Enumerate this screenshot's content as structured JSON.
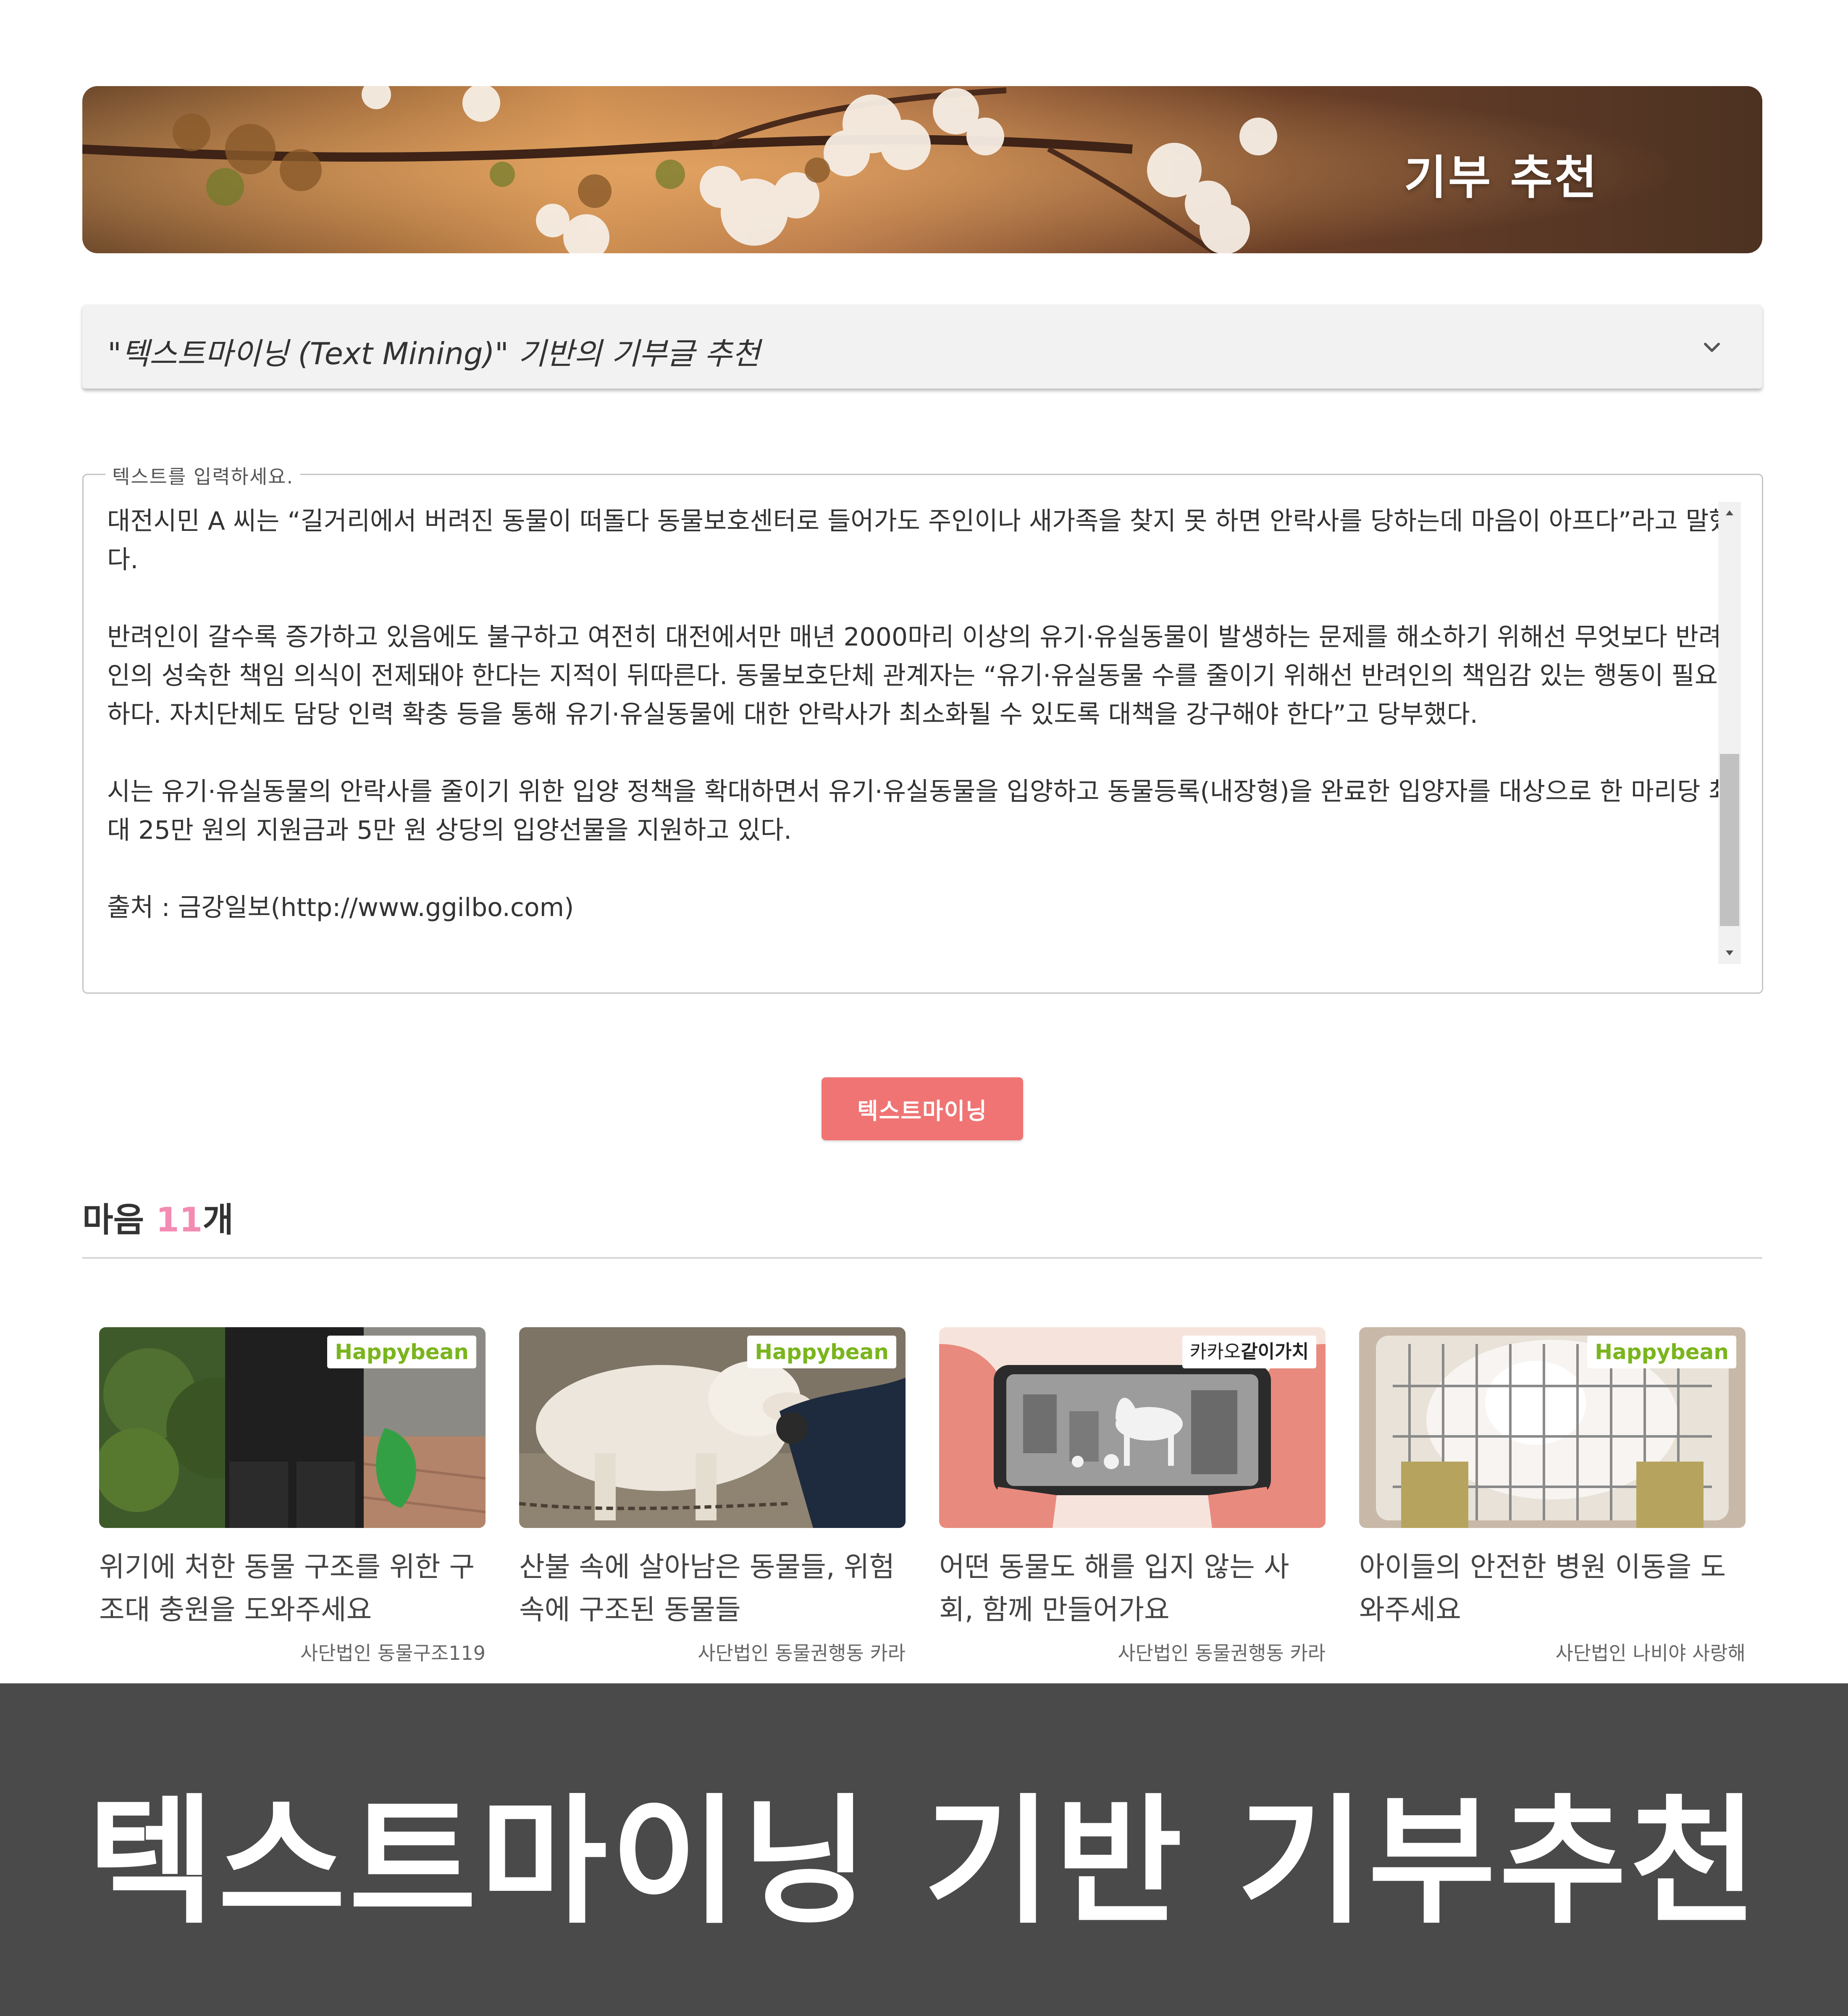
{
  "hero": {
    "title": "기부 추천"
  },
  "accordion": {
    "title": "\"텍스트마이닝 (Text Mining)\" 기반의 기부글 추천"
  },
  "text_input": {
    "legend": "텍스트를 입력하세요.",
    "paragraphs": [
      "대전시민 A 씨는 “길거리에서 버려진 동물이 떠돌다 동물보호센터로 들어가도 주인이나 새가족을 찾지 못 하면 안락사를 당하는데 마음이 아프다”라고 말했다.",
      "반려인이 갈수록 증가하고 있음에도 불구하고 여전히 대전에서만 매년 2000마리 이상의 유기·유실동물이 발생하는 문제를 해소하기 위해선 무엇보다 반려인의 성숙한 책임 의식이 전제돼야 한다는 지적이 뒤따른다. 동물보호단체 관계자는 “유기·유실동물 수를 줄이기 위해선 반려인의 책임감 있는 행동이 필요하다. 자치단체도 담당 인력 확충 등을 통해 유기·유실동물에 대한 안락사가 최소화될 수 있도록 대책을 강구해야 한다”고 당부했다.",
      "시는 유기·유실동물의 안락사를 줄이기 위한 입양 정책을 확대하면서 유기·유실동물을 입양하고 동물등록(내장형)을 완료한 입양자를 대상으로 한 마리당 최대 25만 원의 지원금과 5만 원 상당의 입양선물을 지원하고 있다.",
      "출처 : 금강일보(http://www.ggilbo.com)"
    ]
  },
  "action_button": {
    "label": "텍스트마이닝"
  },
  "results": {
    "prefix": "마음 ",
    "count": "11",
    "suffix": "개"
  },
  "cards": [
    {
      "badge": "Happybean",
      "title": "위기에 처한 동물 구조를 위한 구조대 충원을 도와주세요",
      "org": "사단법인 동물구조119",
      "image": "rescue-worker-photo"
    },
    {
      "badge": "Happybean",
      "title": "산불 속에 살아남은 동물들, 위험 속에 구조된 동물들",
      "org": "사단법인 동물권행동 카라",
      "image": "white-dog-photo"
    },
    {
      "badge_prefix": "카카오",
      "badge": "같이가치",
      "title": "어떤 동물도 해를 입지 않는 사회, 함께 만들어가요",
      "org": "사단법인 동물권행동 카라",
      "image": "phone-horse-illustration"
    },
    {
      "badge": "Happybean",
      "title": "아이들의 안전한 병원 이동을 도와주세요",
      "org": "사단법인 나비야 사랑해",
      "image": "cat-in-carrier-photo"
    }
  ],
  "caption": {
    "text": "텍스트마이닝 기반 기부추천"
  },
  "colors": {
    "accent_button": "#f07474",
    "count_highlight": "#f38bb2",
    "happybean_green": "#7ab51d",
    "caption_bg": "#4a4a4a"
  },
  "icons": {
    "accordion_toggle": "chevron-down-icon",
    "scroll_up": "triangle-up-icon",
    "scroll_down": "triangle-down-icon"
  }
}
